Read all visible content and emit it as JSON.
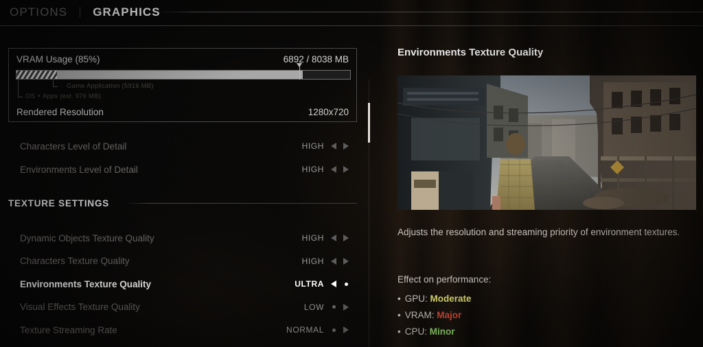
{
  "header": {
    "tab_inactive": "OPTIONS",
    "tab_active": "GRAPHICS"
  },
  "vram": {
    "label": "VRAM Usage (85%)",
    "value": "6892 / 8038 MB",
    "used_mb": 6892,
    "total_mb": 8038,
    "percent": 85,
    "segment_os_label": "OS + Apps (est. 976 MB)",
    "segment_os_mb": 976,
    "segment_game_label": "Game Application (5916 MB)",
    "segment_game_mb": 5916,
    "resolution_label": "Rendered Resolution",
    "resolution_value": "1280x720"
  },
  "settings": {
    "general_rows": [
      {
        "label": "Characters Level of Detail",
        "value": "HIGH",
        "left_enabled": true,
        "right_enabled": true,
        "selected": false
      },
      {
        "label": "Environments Level of Detail",
        "value": "HIGH",
        "left_enabled": true,
        "right_enabled": true,
        "selected": false
      }
    ],
    "section_title": "TEXTURE SETTINGS",
    "texture_rows": [
      {
        "label": "Dynamic Objects Texture Quality",
        "value": "HIGH",
        "left_enabled": true,
        "right_enabled": true,
        "selected": false
      },
      {
        "label": "Characters Texture Quality",
        "value": "HIGH",
        "left_enabled": true,
        "right_enabled": true,
        "selected": false
      },
      {
        "label": "Environments Texture Quality",
        "value": "ULTRA",
        "left_enabled": true,
        "right_enabled": false,
        "selected": true
      },
      {
        "label": "Visual Effects Texture Quality",
        "value": "LOW",
        "left_enabled": false,
        "right_enabled": true,
        "selected": false
      },
      {
        "label": "Texture Streaming Rate",
        "value": "NORMAL",
        "left_enabled": false,
        "right_enabled": true,
        "selected": false
      }
    ]
  },
  "detail": {
    "title": "Environments Texture Quality",
    "preview_alt": "street-scene-preview",
    "description": "Adjusts the resolution and streaming priority of environment textures.",
    "effect_heading": "Effect on performance:",
    "effects": [
      {
        "name": "GPU",
        "value": "Moderate",
        "color": "#d9d972"
      },
      {
        "name": "VRAM",
        "value": "Major",
        "color": "#cc4a38"
      },
      {
        "name": "CPU",
        "value": "Minor",
        "color": "#8ed06c"
      }
    ]
  }
}
